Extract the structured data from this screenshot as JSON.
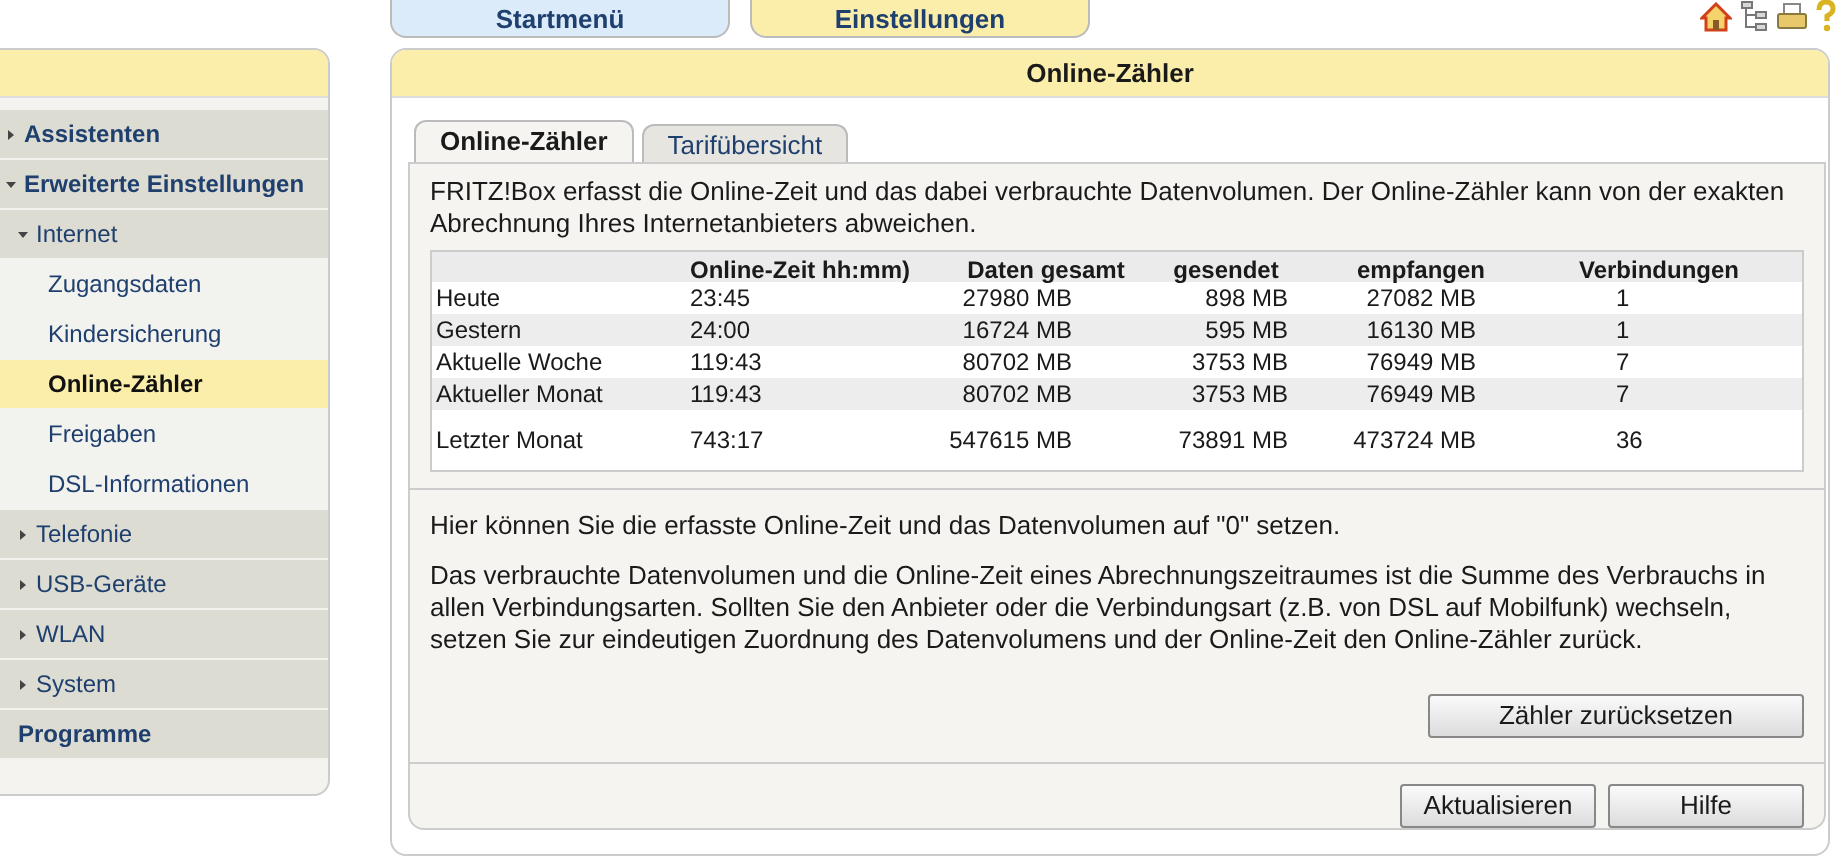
{
  "top_tabs": [
    {
      "label": "Startmenü",
      "selected": false
    },
    {
      "label": "Einstellungen",
      "selected": true
    }
  ],
  "sidebar": {
    "items": [
      {
        "label": "Assistenten",
        "expanded": false
      },
      {
        "label": "Erweiterte Einstellungen",
        "expanded": true,
        "children": [
          {
            "label": "Internet",
            "expanded": true,
            "children": [
              {
                "label": "Zugangsdaten",
                "selected": false
              },
              {
                "label": "Kindersicherung",
                "selected": false
              },
              {
                "label": "Online-Zähler",
                "selected": true
              },
              {
                "label": "Freigaben",
                "selected": false
              },
              {
                "label": "DSL-Informationen",
                "selected": false
              }
            ]
          },
          {
            "label": "Telefonie",
            "expanded": false
          },
          {
            "label": "USB-Geräte",
            "expanded": false
          },
          {
            "label": "WLAN",
            "expanded": false
          },
          {
            "label": "System",
            "expanded": false
          }
        ]
      },
      {
        "label": "Programme"
      }
    ]
  },
  "panel": {
    "title": "Online-Zähler",
    "tabs": [
      {
        "label": "Online-Zähler",
        "selected": true
      },
      {
        "label": "Tarifübersicht",
        "selected": false
      }
    ],
    "intro": "FRITZ!Box erfasst die Online-Zeit und das dabei verbrauchte Datenvolumen. Der Online-Zähler kann von der exakten Abrechnung Ihres Internetanbieters abweichen.",
    "table": {
      "columns": [
        "",
        "Online-Zeit hh:mm)",
        "Daten gesamt",
        "gesendet",
        "empfangen",
        "Verbindungen"
      ],
      "rows": [
        [
          "Heute",
          "23:45",
          "27980 MB",
          "898 MB",
          "27082 MB",
          "1"
        ],
        [
          "Gestern",
          "24:00",
          "16724 MB",
          "595 MB",
          "16130 MB",
          "1"
        ],
        [
          "Aktuelle Woche",
          "119:43",
          "80702 MB",
          "3753 MB",
          "76949 MB",
          "7"
        ],
        [
          "Aktueller Monat",
          "119:43",
          "80702 MB",
          "3753 MB",
          "76949 MB",
          "7"
        ],
        [
          "Letzter Monat",
          "743:17",
          "547615 MB",
          "73891 MB",
          "473724 MB",
          "36"
        ]
      ]
    },
    "reset_note": "Hier können Sie die erfasste Online-Zeit und das Datenvolumen auf \"0\" setzen.",
    "explanation": "Das verbrauchte Datenvolumen und die Online-Zeit eines Abrechnungszeitraumes ist die Summe des Verbrauchs in allen Verbindungsarten. Sollten Sie den Anbieter oder die Verbindungsart (z.B. von DSL auf Mobilfunk) wechseln, setzen Sie zur eindeutigen Zuordnung des Datenvolumens und der Online-Zeit den Online-Zähler zurück.",
    "reset_button": "Zähler zurücksetzen",
    "buttons": [
      "Aktualisieren",
      "Hilfe"
    ]
  }
}
